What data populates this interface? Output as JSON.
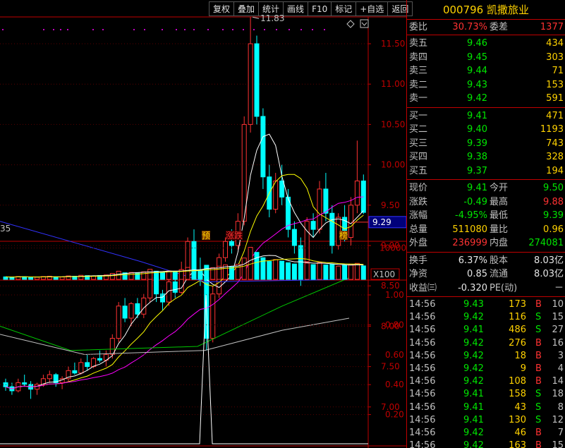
{
  "toolbar": {
    "buttons": [
      "复权",
      "叠加",
      "统计",
      "画线",
      "F10",
      "标记",
      "+自选",
      "返回"
    ]
  },
  "stock": {
    "code": "000796",
    "name": "凯撒旅业"
  },
  "weibi": {
    "label": "委比",
    "value": "30.73%",
    "diff_label": "委差",
    "diff_value": "1377"
  },
  "asks": [
    {
      "label": "卖五",
      "price": "9.46",
      "vol": "434"
    },
    {
      "label": "卖四",
      "price": "9.45",
      "vol": "303"
    },
    {
      "label": "卖三",
      "price": "9.44",
      "vol": "71"
    },
    {
      "label": "卖二",
      "price": "9.43",
      "vol": "153"
    },
    {
      "label": "卖一",
      "price": "9.42",
      "vol": "591"
    }
  ],
  "bids": [
    {
      "label": "买一",
      "price": "9.41",
      "vol": "471"
    },
    {
      "label": "买二",
      "price": "9.40",
      "vol": "1193"
    },
    {
      "label": "买三",
      "price": "9.39",
      "vol": "743"
    },
    {
      "label": "买四",
      "price": "9.38",
      "vol": "328"
    },
    {
      "label": "买五",
      "price": "9.37",
      "vol": "194"
    }
  ],
  "quote": {
    "xianjia_label": "现价",
    "xianjia": "9.41",
    "jinkai_label": "今开",
    "jinkai": "9.50",
    "zhangdie_label": "涨跌",
    "zhangdie": "-0.49",
    "zuigao_label": "最高",
    "zuigao": "9.88",
    "zhangfu_label": "涨幅",
    "zhangfu": "-4.95%",
    "zuidi_label": "最低",
    "zuidi": "9.39",
    "zongliang_label": "总量",
    "zongliang": "511080",
    "liangbi_label": "量比",
    "liangbi": "0.96",
    "waipan_label": "外盘",
    "waipan": "236999",
    "neipan_label": "内盘",
    "neipan": "274081"
  },
  "finance": {
    "huanshou_label": "换手",
    "huanshou": "6.37%",
    "guben_label": "股本",
    "guben": "8.03亿",
    "jingzi_label": "净资",
    "jingzi": "0.85",
    "liutong_label": "流通",
    "liutong": "8.03亿",
    "shouyi_label": "收益㈢",
    "shouyi": "-0.320",
    "pe_label": "PE(动)",
    "pe": "－"
  },
  "ticks": [
    {
      "time": "14:56",
      "price": "9.43",
      "vol": "173",
      "bs": "B",
      "n": "10"
    },
    {
      "time": "14:56",
      "price": "9.42",
      "vol": "116",
      "bs": "S",
      "n": "15"
    },
    {
      "time": "14:56",
      "price": "9.41",
      "vol": "486",
      "bs": "S",
      "n": "27"
    },
    {
      "time": "14:56",
      "price": "9.42",
      "vol": "276",
      "bs": "B",
      "n": "16"
    },
    {
      "time": "14:56",
      "price": "9.42",
      "vol": "18",
      "bs": "B",
      "n": "3"
    },
    {
      "time": "14:56",
      "price": "9.42",
      "vol": "9",
      "bs": "B",
      "n": "4"
    },
    {
      "time": "14:56",
      "price": "9.42",
      "vol": "108",
      "bs": "B",
      "n": "14"
    },
    {
      "time": "14:56",
      "price": "9.41",
      "vol": "158",
      "bs": "S",
      "n": "18"
    },
    {
      "time": "14:56",
      "price": "9.41",
      "vol": "43",
      "bs": "S",
      "n": "8"
    },
    {
      "time": "14:56",
      "price": "9.41",
      "vol": "130",
      "bs": "S",
      "n": "12"
    },
    {
      "time": "14:56",
      "price": "9.42",
      "vol": "46",
      "bs": "B",
      "n": "7"
    },
    {
      "time": "14:56",
      "price": "9.42",
      "vol": "163",
      "bs": "B",
      "n": "15"
    },
    {
      "time": "14:57",
      "price": "9.42",
      "vol": "74",
      "bs": "B",
      "n": "8"
    }
  ],
  "kline": {
    "price_axis": [
      "11.50",
      "11.00",
      "10.50",
      "10.00",
      "9.50",
      "9.00",
      "8.50",
      "8.00",
      "7.50",
      "7.00"
    ],
    "current_price_label": "9.29",
    "high_label": "11.83",
    "left_edge_label": "35",
    "markers": [
      "预",
      "涨",
      "跌",
      "榜"
    ],
    "volume_axis": [
      "10000"
    ],
    "volume_unit": "X100",
    "indicator_axis": [
      "1.00",
      "0.80",
      "0.60",
      "0.40",
      "0.20"
    ],
    "candles": [
      [
        7.3,
        7.35,
        7.2,
        7.25
      ],
      [
        7.25,
        7.3,
        7.15,
        7.2
      ],
      [
        7.2,
        7.35,
        7.18,
        7.3
      ],
      [
        7.3,
        7.4,
        7.25,
        7.28
      ],
      [
        7.28,
        7.32,
        7.1,
        7.22
      ],
      [
        7.22,
        7.3,
        7.15,
        7.28
      ],
      [
        7.28,
        7.4,
        7.25,
        7.35
      ],
      [
        7.35,
        7.45,
        7.3,
        7.4
      ],
      [
        7.4,
        7.42,
        7.25,
        7.3
      ],
      [
        7.3,
        7.38,
        7.22,
        7.35
      ],
      [
        7.35,
        7.5,
        7.32,
        7.45
      ],
      [
        7.45,
        7.55,
        7.4,
        7.42
      ],
      [
        7.42,
        7.6,
        7.4,
        7.55
      ],
      [
        7.55,
        7.65,
        7.45,
        7.5
      ],
      [
        7.5,
        7.62,
        7.48,
        7.6
      ],
      [
        7.6,
        7.7,
        7.55,
        7.58
      ],
      [
        7.58,
        7.7,
        7.5,
        7.65
      ],
      [
        7.65,
        7.9,
        7.6,
        7.85
      ],
      [
        7.85,
        8.3,
        7.8,
        8.25
      ],
      [
        8.25,
        8.35,
        8.05,
        8.1
      ],
      [
        8.1,
        8.3,
        8.0,
        8.28
      ],
      [
        8.28,
        8.35,
        8.1,
        8.15
      ],
      [
        8.15,
        8.4,
        8.1,
        8.35
      ],
      [
        8.35,
        8.7,
        8.3,
        8.6
      ],
      [
        8.6,
        8.65,
        8.3,
        8.4
      ],
      [
        8.4,
        8.45,
        8.2,
        8.3
      ],
      [
        8.3,
        8.6,
        8.25,
        8.55
      ],
      [
        8.55,
        8.65,
        8.35,
        8.42
      ],
      [
        8.42,
        8.8,
        8.4,
        8.7
      ],
      [
        8.7,
        9.1,
        8.65,
        9.05
      ],
      [
        9.05,
        9.2,
        8.6,
        8.7
      ],
      [
        8.7,
        8.85,
        8.5,
        8.6
      ],
      [
        8.6,
        8.65,
        7.7,
        7.85
      ],
      [
        7.85,
        8.5,
        7.8,
        8.4
      ],
      [
        8.4,
        8.9,
        8.35,
        8.85
      ],
      [
        8.85,
        9.1,
        8.8,
        9.05
      ],
      [
        9.05,
        9.2,
        8.9,
        9.0
      ],
      [
        9.0,
        9.4,
        8.95,
        9.3
      ],
      [
        9.3,
        10.6,
        9.25,
        10.5
      ],
      [
        10.5,
        11.83,
        10.4,
        11.5
      ],
      [
        11.5,
        11.6,
        10.5,
        10.6
      ],
      [
        10.6,
        10.7,
        9.7,
        9.85
      ],
      [
        9.85,
        10.0,
        9.35,
        9.45
      ],
      [
        9.45,
        9.9,
        9.4,
        9.8
      ],
      [
        9.8,
        10.0,
        9.5,
        9.6
      ],
      [
        9.6,
        9.7,
        9.1,
        9.2
      ],
      [
        9.2,
        9.3,
        8.9,
        9.0
      ],
      [
        9.0,
        9.1,
        8.5,
        8.8
      ],
      [
        8.8,
        9.35,
        8.75,
        9.3
      ],
      [
        9.3,
        9.4,
        9.1,
        9.2
      ],
      [
        9.2,
        9.8,
        9.15,
        9.7
      ],
      [
        9.7,
        9.9,
        9.3,
        9.4
      ],
      [
        9.4,
        9.5,
        8.9,
        9.0
      ],
      [
        9.0,
        9.4,
        8.95,
        9.35
      ],
      [
        9.35,
        9.5,
        9.05,
        9.1
      ],
      [
        9.1,
        9.6,
        9.0,
        9.5
      ],
      [
        9.5,
        10.3,
        9.4,
        9.8
      ],
      [
        9.8,
        9.88,
        9.39,
        9.41
      ]
    ],
    "volumes": [
      800,
      700,
      900,
      850,
      650,
      700,
      900,
      1000,
      800,
      750,
      1100,
      1000,
      1300,
      1200,
      1100,
      1250,
      1400,
      1900,
      2600,
      2100,
      2200,
      2000,
      2400,
      3200,
      2600,
      2300,
      2700,
      2500,
      3100,
      3800,
      3000,
      2900,
      4500,
      3700,
      4200,
      4600,
      4000,
      4800,
      6800,
      10200,
      8600,
      6900,
      5700,
      6300,
      5800,
      5300,
      4900,
      5700,
      5200,
      4700,
      5400,
      4600,
      4800,
      4200,
      4500,
      4700,
      5100,
      4300
    ],
    "indicator": {
      "peak_value": 1.0
    }
  }
}
